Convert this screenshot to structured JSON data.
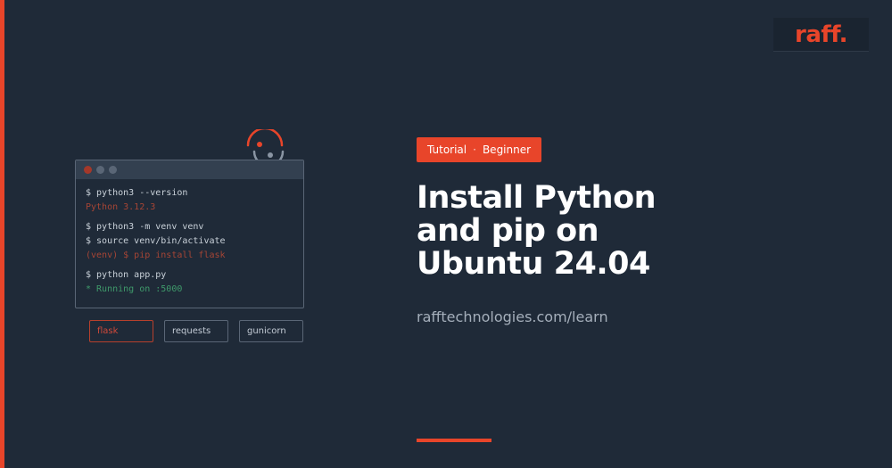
{
  "brand": {
    "logo_text": "raff.",
    "accent_color": "#e8452a",
    "background_color": "#1f2a38"
  },
  "terminal": {
    "lines": [
      {
        "text": "$ python3 --version",
        "kind": "command"
      },
      {
        "text": "Python 3.12.3",
        "kind": "output"
      },
      {
        "text": "$ python3 -m venv venv",
        "kind": "command"
      },
      {
        "text": "$ source venv/bin/activate",
        "kind": "command"
      },
      {
        "text": "(venv) $ pip install flask",
        "kind": "output"
      },
      {
        "text": "$ python app.py",
        "kind": "command"
      },
      {
        "text": "* Running on :5000",
        "kind": "success"
      }
    ]
  },
  "packages": [
    "flask",
    "requests",
    "gunicorn"
  ],
  "badge": {
    "category": "Tutorial",
    "separator": "·",
    "level": "Beginner"
  },
  "title_lines": [
    "Install Python",
    "and pip on",
    "Ubuntu 24.04"
  ],
  "url": "rafftechnologies.com/learn"
}
